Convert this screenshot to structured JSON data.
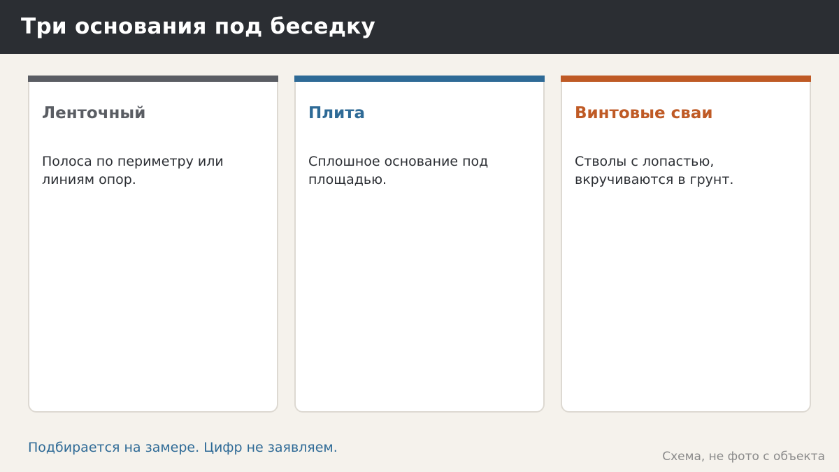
{
  "header": {
    "title": "Три основания под беседку"
  },
  "cards": [
    {
      "title": "Ленточный",
      "text": "Полоса по периметру или линиям опор.",
      "color": "#5a5d63"
    },
    {
      "title": "Плита",
      "text": "Сплошное основание под площадью.",
      "color": "#2e6a96"
    },
    {
      "title": "Винтовые сваи",
      "text": "Стволы с лопастью, вкручиваются в грунт.",
      "color": "#bf5a25"
    }
  ],
  "footer": {
    "note": "Подбирается на замере. Цифр не заявляем.",
    "caption": "Схема, не фото с объекта"
  }
}
